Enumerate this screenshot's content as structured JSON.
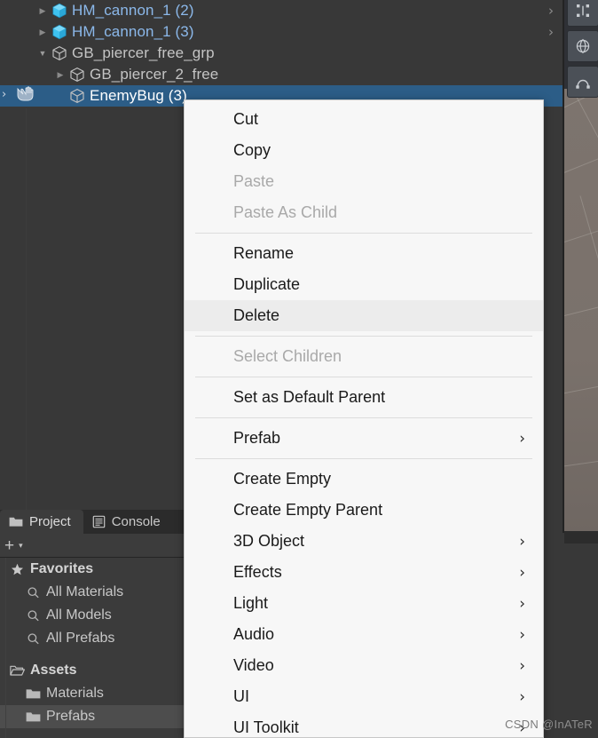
{
  "app": {
    "name": "Unity Editor",
    "theme_bg": "#383838",
    "accent_selection": "#2c5d87"
  },
  "hierarchy": {
    "name": "Hierarchy",
    "rows": [
      {
        "label": "HM_cannon_1 (2)",
        "indent": 2,
        "twisty": "collapsed",
        "icon": "prefab-cube-icon",
        "prefab": true,
        "selected": false,
        "chevron": "›"
      },
      {
        "label": "HM_cannon_1 (3)",
        "indent": 2,
        "twisty": "collapsed",
        "icon": "prefab-cube-icon",
        "prefab": true,
        "selected": false,
        "chevron": "›"
      },
      {
        "label": "GB_piercer_free_grp",
        "indent": 2,
        "twisty": "expanded",
        "icon": "gameobject-cube-icon",
        "prefab": false,
        "selected": false,
        "chevron": ""
      },
      {
        "label": "GB_piercer_2_free",
        "indent": 3,
        "twisty": "collapsed",
        "icon": "gameobject-cube-icon",
        "prefab": false,
        "selected": false,
        "chevron": ""
      },
      {
        "label": "EnemyBug (3)",
        "indent": 3,
        "twisty": "none",
        "icon": "gameobject-cube-icon",
        "prefab": false,
        "selected": true,
        "chevron": ""
      }
    ]
  },
  "scene_tools": [
    {
      "name": "move-tool-gizmo-icon"
    },
    {
      "name": "orientation-gizmo-icon"
    },
    {
      "name": "path-tool-gizmo-icon"
    }
  ],
  "project_panel": {
    "tabs": [
      {
        "label": "Project",
        "icon": "folder-icon",
        "active": true
      },
      {
        "label": "Console",
        "icon": "console-icon",
        "active": false
      }
    ],
    "toolbar": {
      "add_label": "+",
      "caret_label": "▾"
    },
    "tree": [
      {
        "label": "Favorites",
        "icon": "star-icon",
        "indent": 0,
        "bold": true,
        "selected": false,
        "twisty": "expanded"
      },
      {
        "label": "All Materials",
        "icon": "search-icon",
        "indent": 1,
        "bold": false,
        "selected": false,
        "twisty": "none"
      },
      {
        "label": "All Models",
        "icon": "search-icon",
        "indent": 1,
        "bold": false,
        "selected": false,
        "twisty": "none"
      },
      {
        "label": "All Prefabs",
        "icon": "search-icon",
        "indent": 1,
        "bold": false,
        "selected": false,
        "twisty": "none"
      },
      {
        "label": "",
        "icon": "spacer",
        "indent": 0,
        "bold": false,
        "selected": false,
        "twisty": "none"
      },
      {
        "label": "Assets",
        "icon": "folder-open-icon",
        "indent": 0,
        "bold": true,
        "selected": false,
        "twisty": "expanded"
      },
      {
        "label": "Materials",
        "icon": "folder-icon",
        "indent": 1,
        "bold": false,
        "selected": false,
        "twisty": "none"
      },
      {
        "label": "Prefabs",
        "icon": "folder-icon",
        "indent": 1,
        "bold": false,
        "selected": true,
        "twisty": "none"
      }
    ]
  },
  "context_menu": {
    "name": "hierarchy-context-menu",
    "items": [
      {
        "label": "Cut",
        "type": "item",
        "enabled": true,
        "highlight": false,
        "submenu": false
      },
      {
        "label": "Copy",
        "type": "item",
        "enabled": true,
        "highlight": false,
        "submenu": false
      },
      {
        "label": "Paste",
        "type": "item",
        "enabled": false,
        "highlight": false,
        "submenu": false
      },
      {
        "label": "Paste As Child",
        "type": "item",
        "enabled": false,
        "highlight": false,
        "submenu": false
      },
      {
        "label": "",
        "type": "separator",
        "enabled": true,
        "highlight": false,
        "submenu": false
      },
      {
        "label": "Rename",
        "type": "item",
        "enabled": true,
        "highlight": false,
        "submenu": false
      },
      {
        "label": "Duplicate",
        "type": "item",
        "enabled": true,
        "highlight": false,
        "submenu": false
      },
      {
        "label": "Delete",
        "type": "item",
        "enabled": true,
        "highlight": true,
        "submenu": false
      },
      {
        "label": "",
        "type": "separator",
        "enabled": true,
        "highlight": false,
        "submenu": false
      },
      {
        "label": "Select Children",
        "type": "item",
        "enabled": false,
        "highlight": false,
        "submenu": false
      },
      {
        "label": "",
        "type": "separator",
        "enabled": true,
        "highlight": false,
        "submenu": false
      },
      {
        "label": "Set as Default Parent",
        "type": "item",
        "enabled": true,
        "highlight": false,
        "submenu": false
      },
      {
        "label": "",
        "type": "separator",
        "enabled": true,
        "highlight": false,
        "submenu": false
      },
      {
        "label": "Prefab",
        "type": "item",
        "enabled": true,
        "highlight": false,
        "submenu": true
      },
      {
        "label": "",
        "type": "separator",
        "enabled": true,
        "highlight": false,
        "submenu": false
      },
      {
        "label": "Create Empty",
        "type": "item",
        "enabled": true,
        "highlight": false,
        "submenu": false
      },
      {
        "label": "Create Empty Parent",
        "type": "item",
        "enabled": true,
        "highlight": false,
        "submenu": false
      },
      {
        "label": "3D Object",
        "type": "item",
        "enabled": true,
        "highlight": false,
        "submenu": true
      },
      {
        "label": "Effects",
        "type": "item",
        "enabled": true,
        "highlight": false,
        "submenu": true
      },
      {
        "label": "Light",
        "type": "item",
        "enabled": true,
        "highlight": false,
        "submenu": true
      },
      {
        "label": "Audio",
        "type": "item",
        "enabled": true,
        "highlight": false,
        "submenu": true
      },
      {
        "label": "Video",
        "type": "item",
        "enabled": true,
        "highlight": false,
        "submenu": true
      },
      {
        "label": "UI",
        "type": "item",
        "enabled": true,
        "highlight": false,
        "submenu": true
      },
      {
        "label": "UI Toolkit",
        "type": "item",
        "enabled": true,
        "highlight": false,
        "submenu": true
      }
    ],
    "submenu_arrow": "›"
  },
  "watermark": {
    "prefix": "CSDN",
    "handle": "@InATeR"
  }
}
